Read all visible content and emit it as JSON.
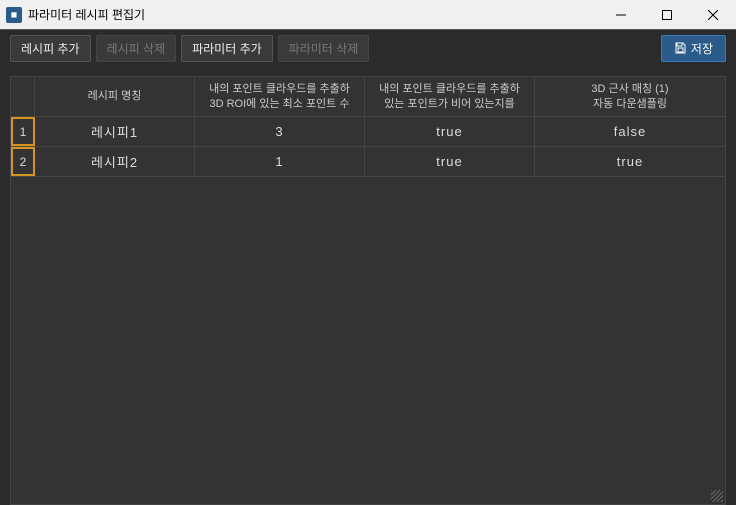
{
  "window": {
    "title": "파라미터 레시피 편집기"
  },
  "toolbar": {
    "add_recipe": "레시피 추가",
    "delete_recipe": "레시피 삭제",
    "add_parameter": "파라미터 추가",
    "delete_parameter": "파라미터 삭제",
    "save": "저장"
  },
  "table": {
    "headers": {
      "name": "레시피 명칭",
      "col1_line1": "내의 포인트 클라우드를 추출하",
      "col1_line2": "3D ROI에 있는 최소 포인트 수",
      "col2_line1": "내의 포인트 클라우드를 추출하",
      "col2_line2": "있는 포인트가 비어 있는지를",
      "col3_line1": "3D 근사 매칭 (1)",
      "col3_line2": "자동 다운샘플링"
    },
    "rows": [
      {
        "num": "1",
        "name": "레시피1",
        "col1": "3",
        "col2": "true",
        "col3": "false"
      },
      {
        "num": "2",
        "name": "레시피2",
        "col1": "1",
        "col2": "true",
        "col3": "true"
      }
    ]
  }
}
